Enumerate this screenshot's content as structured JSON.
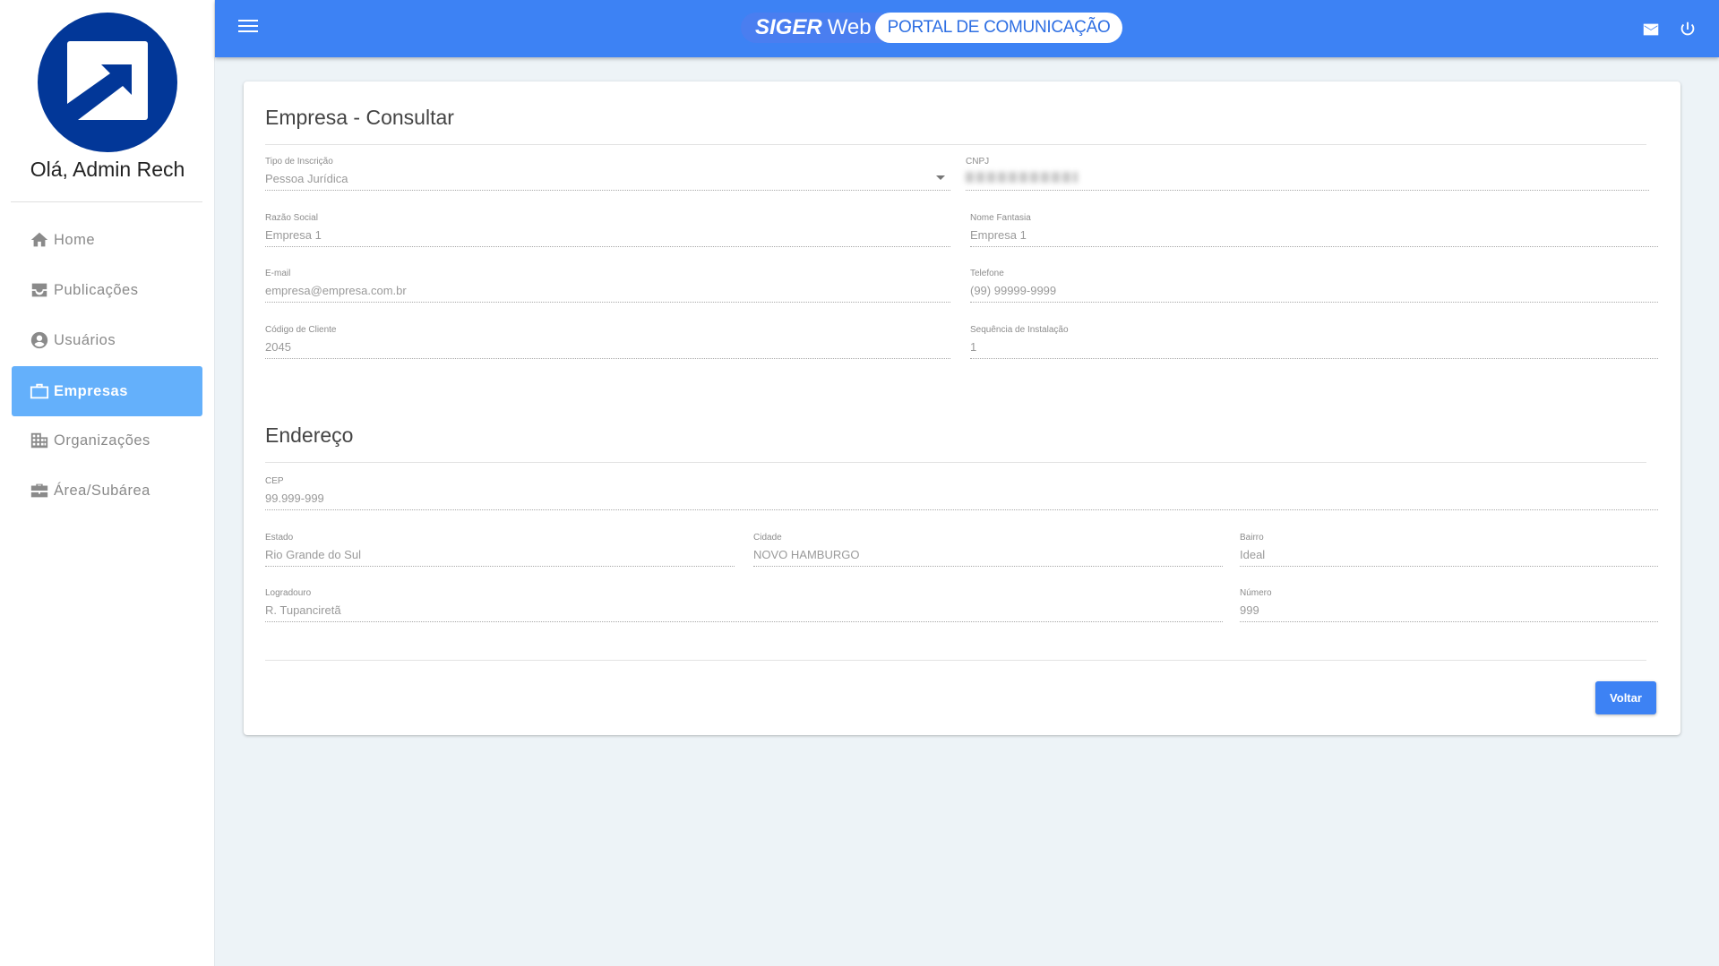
{
  "sidebar": {
    "greeting": "Olá, Admin Rech",
    "items": [
      {
        "label": "Home",
        "icon": "home-icon"
      },
      {
        "label": "Publicações",
        "icon": "inbox-icon"
      },
      {
        "label": "Usuários",
        "icon": "account-circle-icon"
      },
      {
        "label": "Empresas",
        "icon": "briefcase-icon",
        "active": true
      },
      {
        "label": "Organizações",
        "icon": "building-icon"
      },
      {
        "label": "Área/Subárea",
        "icon": "work-icon"
      }
    ]
  },
  "header": {
    "logo_main": "SIGER",
    "logo_sub": "Web",
    "portal": "PORTAL DE COMUNICAÇÃO"
  },
  "form": {
    "title": "Empresa - Consultar",
    "fields": {
      "tipo": {
        "label": "Tipo de Inscrição",
        "value": "Pessoa Jurídica"
      },
      "cnpj": {
        "label": "CNPJ"
      },
      "razao": {
        "label": "Razão Social",
        "value": "Empresa 1"
      },
      "fantasia": {
        "label": "Nome Fantasia",
        "value": "Empresa 1"
      },
      "email": {
        "label": "E-mail",
        "value": "empresa@empresa.com.br"
      },
      "telefone": {
        "label": "Telefone",
        "value": "(99) 99999-9999"
      },
      "codigo": {
        "label": "Código de Cliente",
        "value": "2045"
      },
      "sequencia": {
        "label": "Sequência de Instalação",
        "value": "1"
      }
    },
    "address_title": "Endereço",
    "address": {
      "cep": {
        "label": "CEP",
        "value": "99.999-999"
      },
      "estado": {
        "label": "Estado",
        "value": "Rio Grande do Sul"
      },
      "cidade": {
        "label": "Cidade",
        "value": "NOVO HAMBURGO"
      },
      "bairro": {
        "label": "Bairro",
        "value": "Ideal"
      },
      "logradouro": {
        "label": "Logradouro",
        "value": "R. Tupanciretã"
      },
      "numero": {
        "label": "Número",
        "value": "999"
      }
    },
    "back_label": "Voltar"
  }
}
